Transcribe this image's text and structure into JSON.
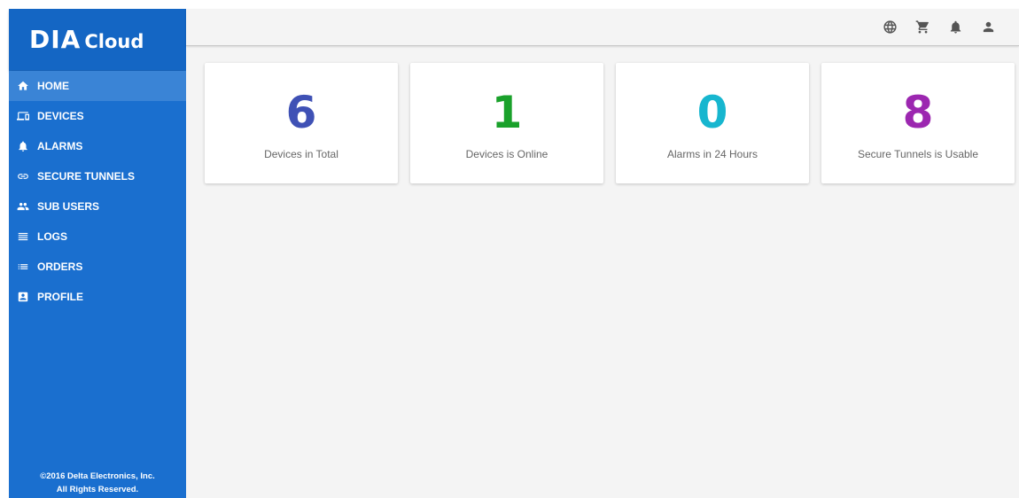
{
  "brand": {
    "dia": "DIA",
    "cloud": "Cloud"
  },
  "sidebar": {
    "items": [
      {
        "label": "HOME",
        "icon": "home-icon",
        "active": true
      },
      {
        "label": "DEVICES",
        "icon": "devices-icon",
        "active": false
      },
      {
        "label": "ALARMS",
        "icon": "bell-icon",
        "active": false
      },
      {
        "label": "SECURE TUNNELS",
        "icon": "link-icon",
        "active": false
      },
      {
        "label": "SUB USERS",
        "icon": "group-icon",
        "active": false
      },
      {
        "label": "LOGS",
        "icon": "lines-icon",
        "active": false
      },
      {
        "label": "ORDERS",
        "icon": "list-icon",
        "active": false
      },
      {
        "label": "PROFILE",
        "icon": "contact-card-icon",
        "active": false
      }
    ],
    "footer_line1": "©2016 Delta Electronics, Inc.",
    "footer_line2": "All Rights Reserved."
  },
  "topbar": {
    "icons": [
      "globe-icon",
      "cart-icon",
      "bell-icon",
      "user-icon"
    ]
  },
  "cards": [
    {
      "value": "6",
      "label": "Devices in Total",
      "color": "#3f51b5"
    },
    {
      "value": "1",
      "label": "Devices is Online",
      "color": "#1aa12b"
    },
    {
      "value": "0",
      "label": "Alarms in 24 Hours",
      "color": "#17b6cf"
    },
    {
      "value": "8",
      "label": "Secure Tunnels is Usable",
      "color": "#9c27b0"
    }
  ],
  "colors": {
    "sidebar": "#1a6fcf",
    "sidebar_active": "#3a84d6",
    "background": "#f4f4f4"
  }
}
